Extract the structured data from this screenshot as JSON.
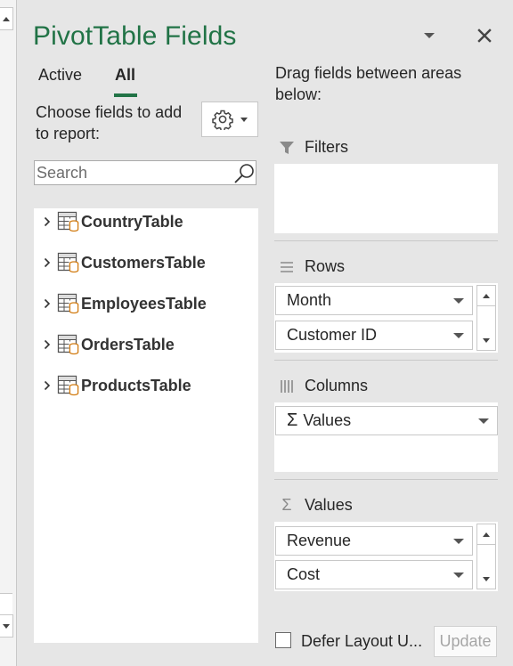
{
  "pane": {
    "title": "PivotTable Fields",
    "accent_color": "#217346"
  },
  "tabs": [
    {
      "label": "Active",
      "selected": false
    },
    {
      "label": "All",
      "selected": true
    }
  ],
  "chooser": {
    "label": "Choose fields to add to report:",
    "tools_icon": "gear-icon"
  },
  "search": {
    "placeholder": "Search",
    "value": ""
  },
  "fields": [
    {
      "name": "CountryTable",
      "icon": "data-table-icon"
    },
    {
      "name": "CustomersTable",
      "icon": "data-table-icon"
    },
    {
      "name": "EmployeesTable",
      "icon": "data-table-icon"
    },
    {
      "name": "OrdersTable",
      "icon": "data-table-icon"
    },
    {
      "name": "ProductsTable",
      "icon": "data-table-icon"
    }
  ],
  "drag_hint": "Drag fields between areas below:",
  "areas": {
    "filters": {
      "label": "Filters",
      "icon": "filter-icon",
      "items": []
    },
    "rows": {
      "label": "Rows",
      "icon": "rows-icon",
      "items": [
        "Month",
        "Customer ID"
      ]
    },
    "columns": {
      "label": "Columns",
      "icon": "columns-icon",
      "items": [
        "Values"
      ],
      "item_icon": "sigma-icon"
    },
    "values": {
      "label": "Values",
      "icon": "sigma-icon",
      "items": [
        "Revenue",
        "Cost"
      ]
    }
  },
  "footer": {
    "defer_label": "Defer Layout U...",
    "defer_checked": false,
    "update_label": "Update",
    "update_enabled": false
  }
}
